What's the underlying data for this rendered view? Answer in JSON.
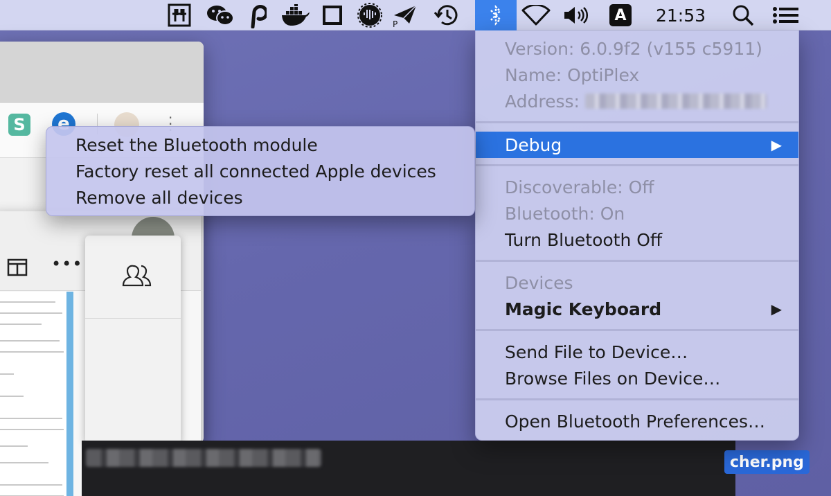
{
  "menubar": {
    "icons": [
      "hashtag-app-icon",
      "wechat-icon",
      "pastebot-icon",
      "docker-icon",
      "square-app-icon",
      "audio-hijack-icon",
      "paper-plane-icon",
      "time-machine-icon",
      "bluetooth-icon",
      "wifi-icon",
      "volume-icon"
    ],
    "input_source": "A",
    "clock": "21:53"
  },
  "background": {
    "ext_s_label": "S",
    "ext_e_label": "e",
    "file_label": "cher.png"
  },
  "bluetooth_menu": {
    "version": "Version: 6.0.9f2 (v155 c5911)",
    "name": "Name: OptiPlex",
    "address_label": "Address:",
    "debug": "Debug",
    "discoverable": "Discoverable: Off",
    "bluetooth_state": "Bluetooth: On",
    "turn_off": "Turn Bluetooth Off",
    "devices_header": "Devices",
    "device_1": "Magic Keyboard",
    "send_file": "Send File to Device…",
    "browse_files": "Browse Files on Device…",
    "open_prefs": "Open Bluetooth Preferences…",
    "submenu_arrow": "▶",
    "accent_color": "#2b72e0"
  },
  "debug_submenu": {
    "items": [
      "Reset the Bluetooth module",
      "Factory reset all connected Apple devices",
      "Remove all devices"
    ]
  }
}
